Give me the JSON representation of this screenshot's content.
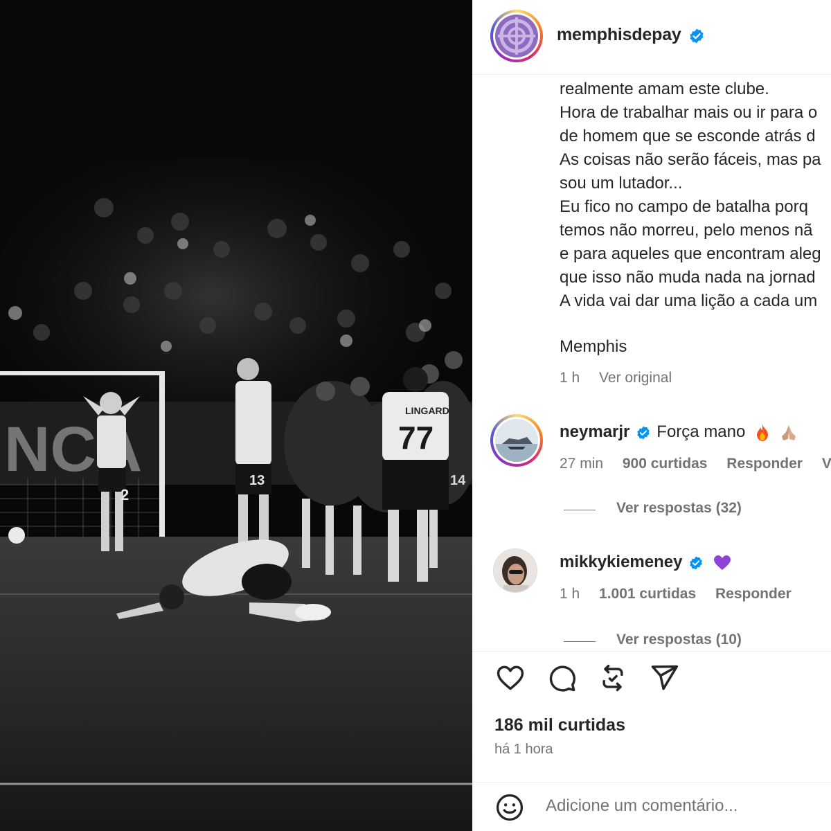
{
  "post": {
    "author": "memphisdepay",
    "caption_lines": [
      "realmente amam este clube.",
      "Hora de trabalhar mais ou ir para o",
      "de homem que se esconde atrás d",
      "As coisas não serão fáceis, mas pa",
      "sou um lutador...",
      "Eu fico no campo de batalha porq",
      "temos não morreu, pelo menos nã",
      "e para aqueles que encontram aleg",
      "que isso não muda nada na jornad",
      "A vida vai dar uma lição a cada um"
    ],
    "signature": "Memphis",
    "caption_time": "1 h",
    "see_original": "Ver original",
    "likes": "186 mil curtidas",
    "posted_ago": "há 1 hora",
    "add_comment_placeholder": "Adicione um comentário..."
  },
  "comments": [
    {
      "username": "neymarjr",
      "text": "Força mano",
      "emojis": [
        "fire-emoji",
        "praying-hands-emoji"
      ],
      "time": "27 min",
      "likes": "900 curtidas",
      "reply": "Responder",
      "more": "Ve",
      "view_replies": "Ver respostas (32)"
    },
    {
      "username": "mikkykiemeney",
      "text": "",
      "emojis": [
        "purple-heart-emoji"
      ],
      "time": "1 h",
      "likes": "1.001 curtidas",
      "reply": "Responder",
      "view_replies": "Ver respostas (10)"
    }
  ],
  "photo": {
    "jersey_numbers": [
      "77",
      "13",
      "2",
      "14"
    ],
    "jersey_name": "LINGARD"
  },
  "colors": {
    "verified": "#0095f6",
    "text_primary": "#262626",
    "text_secondary": "#737373",
    "avatar_purple": "#8e6bbf"
  }
}
